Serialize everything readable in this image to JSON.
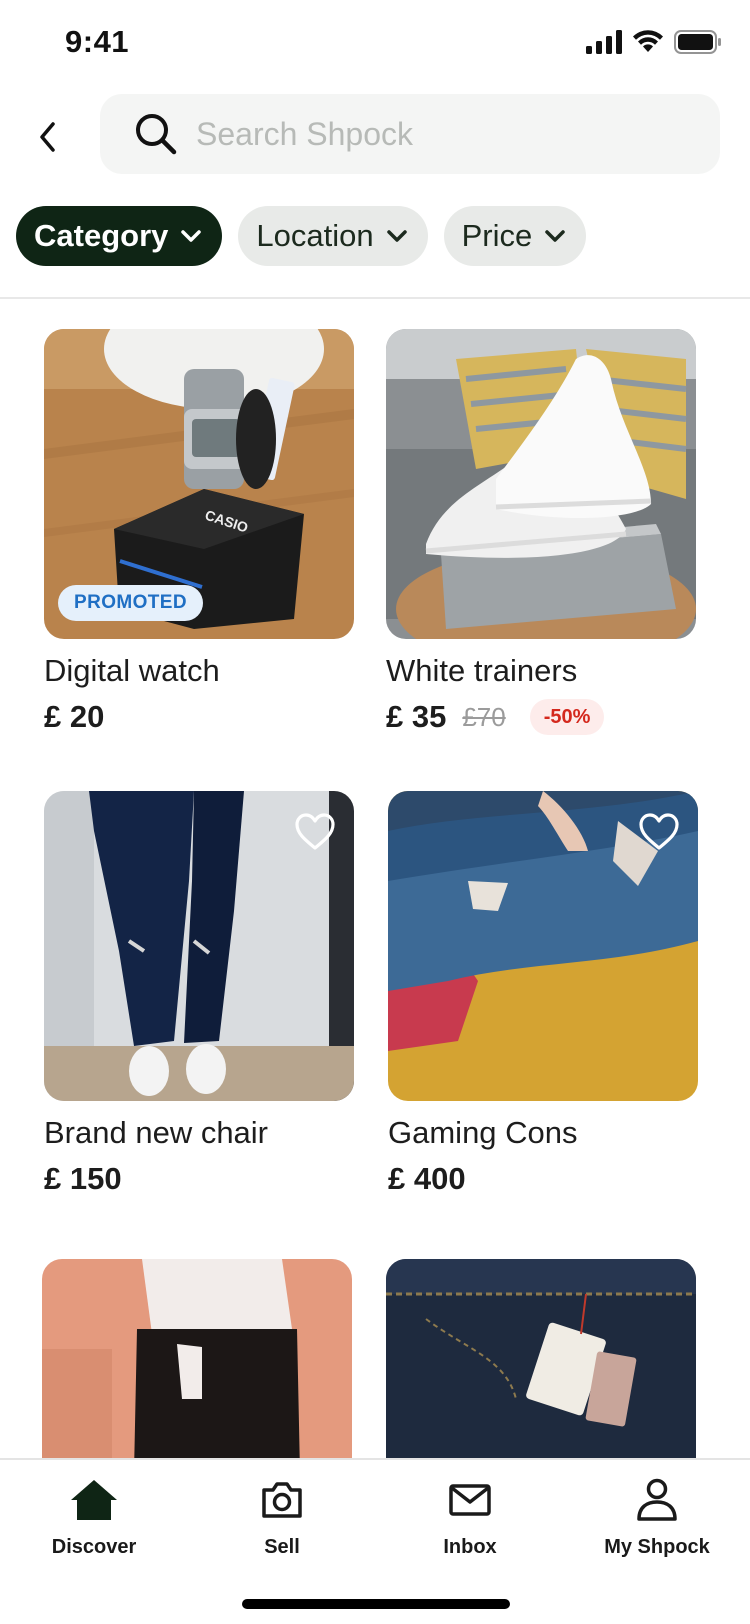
{
  "status_bar": {
    "time": "9:41"
  },
  "search": {
    "placeholder": "Search Shpock",
    "value": ""
  },
  "filters": [
    {
      "label": "Category",
      "active": true
    },
    {
      "label": "Location",
      "active": false
    },
    {
      "label": "Price",
      "active": false
    }
  ],
  "listings": [
    {
      "title": "Digital watch",
      "price": "£ 20",
      "badge": "PROMOTED"
    },
    {
      "title": "White trainers",
      "price": "£ 35",
      "old_price": "£70",
      "discount": "-50%"
    },
    {
      "title": "Brand new chair",
      "price": "£ 150"
    },
    {
      "title": "Gaming Cons",
      "price": "£ 400"
    },
    {
      "title": "",
      "price": ""
    },
    {
      "title": "",
      "price": ""
    }
  ],
  "tabs": [
    {
      "label": "Discover",
      "icon": "home-icon"
    },
    {
      "label": "Sell",
      "icon": "camera-icon"
    },
    {
      "label": "Inbox",
      "icon": "mail-icon"
    },
    {
      "label": "My Shpock",
      "icon": "user-icon"
    }
  ],
  "colors": {
    "brand_dark": "#0f2515",
    "chip_bg": "#e8eae8",
    "promoted_text": "#1f6fc4",
    "discount_text": "#d4281d"
  }
}
